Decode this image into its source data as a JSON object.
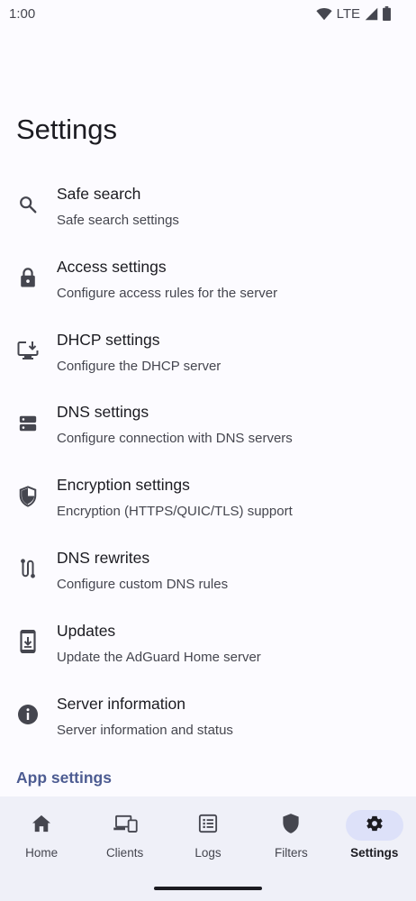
{
  "status_bar": {
    "time": "1:00",
    "network": "LTE",
    "icons": [
      "wifi-icon",
      "signal-icon",
      "battery-icon"
    ]
  },
  "page": {
    "title": "Settings"
  },
  "settings": {
    "items": [
      {
        "title": "Safe search",
        "subtitle": "Safe search settings",
        "icon": "search-icon"
      },
      {
        "title": "Access settings",
        "subtitle": "Configure access rules for the server",
        "icon": "lock-icon"
      },
      {
        "title": "DHCP settings",
        "subtitle": "Configure the DHCP server",
        "icon": "monitor-download-icon"
      },
      {
        "title": "DNS settings",
        "subtitle": "Configure connection with DNS servers",
        "icon": "dns-icon"
      },
      {
        "title": "Encryption settings",
        "subtitle": "Encryption (HTTPS/QUIC/TLS) support",
        "icon": "shield-icon"
      },
      {
        "title": "DNS rewrites",
        "subtitle": "Configure custom DNS rules",
        "icon": "route-icon"
      },
      {
        "title": "Updates",
        "subtitle": "Update the AdGuard Home server",
        "icon": "phone-download-icon"
      },
      {
        "title": "Server information",
        "subtitle": "Server information and status",
        "icon": "info-icon"
      }
    ]
  },
  "section": {
    "app_settings": "App settings"
  },
  "bottom_nav": {
    "items": [
      {
        "label": "Home",
        "icon": "home-icon"
      },
      {
        "label": "Clients",
        "icon": "devices-icon"
      },
      {
        "label": "Logs",
        "icon": "logs-icon"
      },
      {
        "label": "Filters",
        "icon": "shield-icon"
      },
      {
        "label": "Settings",
        "icon": "gear-icon",
        "active": true
      }
    ]
  },
  "colors": {
    "background": "#fcfbff",
    "accent": "#4d5c92",
    "nav_background": "#eff0f8",
    "nav_active_pill": "#dde1f9",
    "text_primary": "#1b1b21",
    "text_secondary": "#45464f"
  }
}
